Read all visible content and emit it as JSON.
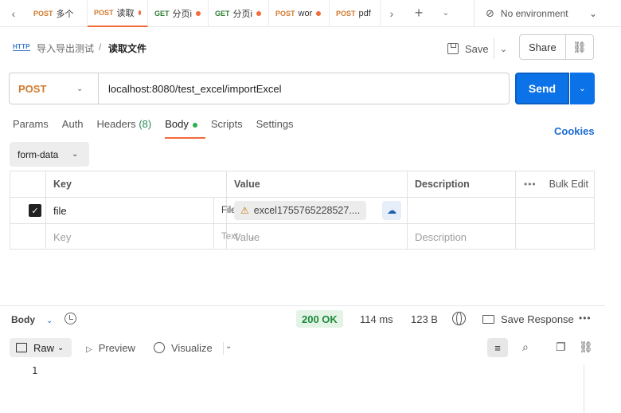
{
  "tabs": [
    {
      "method": "POST",
      "title": "多个",
      "dirty": false,
      "active": false
    },
    {
      "method": "POST",
      "title": "读取",
      "dirty": true,
      "active": true
    },
    {
      "method": "GET",
      "title": "分页i",
      "dirty": true,
      "active": false
    },
    {
      "method": "GET",
      "title": "分页i",
      "dirty": true,
      "active": false
    },
    {
      "method": "POST",
      "title": "wor",
      "dirty": true,
      "active": false
    },
    {
      "method": "POST",
      "title": "pdf",
      "dirty": false,
      "active": false
    }
  ],
  "environment": {
    "label": "No environment"
  },
  "breadcrumb": {
    "parent": "导入导出测试",
    "separator": "/",
    "current": "读取文件",
    "protocol_badge": "HTTP"
  },
  "toolbar": {
    "save_label": "Save",
    "share_label": "Share"
  },
  "request": {
    "method": "POST",
    "url": "localhost:8080/test_excel/importExcel",
    "send_label": "Send"
  },
  "request_tabs": {
    "params": "Params",
    "auth": "Auth",
    "headers": "Headers",
    "headers_count": "(8)",
    "body": "Body",
    "scripts": "Scripts",
    "settings": "Settings",
    "cookies": "Cookies"
  },
  "body_type": "form-data",
  "params_table": {
    "headers": {
      "key": "Key",
      "value": "Value",
      "description": "Description",
      "bulk_edit": "Bulk Edit"
    },
    "rows": [
      {
        "checked": true,
        "key": "file",
        "type": "File",
        "value": "excel1755765228527....",
        "description": ""
      }
    ],
    "placeholder": {
      "key": "Key",
      "type": "Text",
      "value": "Value",
      "description": "Description"
    }
  },
  "response": {
    "body_label": "Body",
    "status": "200 OK",
    "time": "114 ms",
    "size": "123 B",
    "save_response": "Save Response",
    "view_raw": "Raw",
    "view_preview": "Preview",
    "view_visualize": "Visualize",
    "line_number": "1"
  }
}
